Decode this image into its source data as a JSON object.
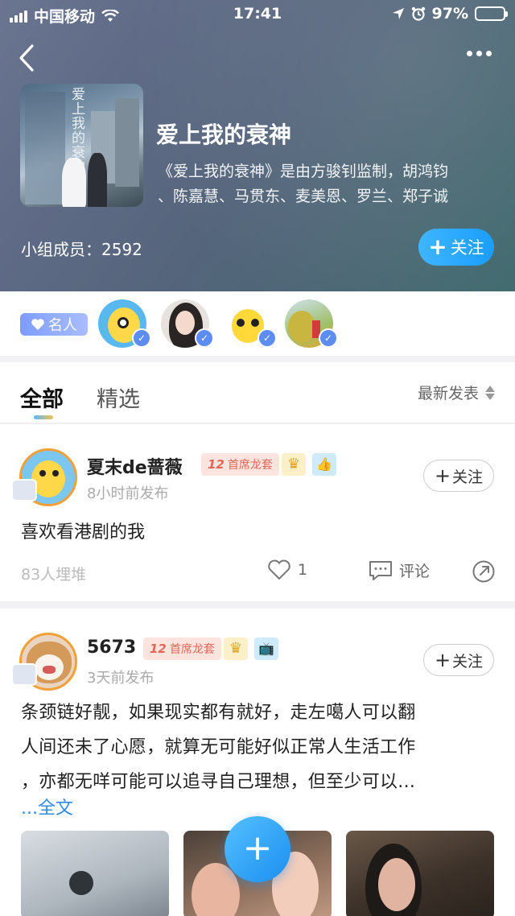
{
  "status_bar": {
    "carrier": "中国移动",
    "time": "17:41",
    "battery": "97%",
    "battery_level": 0.97
  },
  "group": {
    "title": "爱上我的衰神",
    "desc_line1": "《爱上我的衰神》是由方骏钊监制，胡鸿钧",
    "desc_line2": "、陈嘉慧、马贯东、麦美恩、罗兰、郑子诚",
    "members": "小组成员：2592",
    "follow_label": "关注",
    "poster_title": "爱上我的衰神"
  },
  "celebs": {
    "badge_label": "名人",
    "avatars": [
      "celeb-1",
      "celeb-2",
      "celeb-3",
      "celeb-4"
    ]
  },
  "tabs": {
    "all": "全部",
    "selected": "精选",
    "sort": "最新发表"
  },
  "posts": [
    {
      "name": "夏末de蔷薇",
      "level": "12",
      "rank": "首席龙套",
      "time": "8小时前发布",
      "text": "喜欢看港剧的我",
      "stat": "83人埋堆",
      "likes": "1",
      "comment": "评论",
      "follow": "关注"
    },
    {
      "name": "5673",
      "level": "12",
      "rank": "首席龙套",
      "time": "3天前发布",
      "text_line1": "条颈链好靓，如果现实都有就好，走左噶人可以翻",
      "text_line2": "人间还未了心愿，就算无可能好似正常人生活工作",
      "text_line3": "，亦都无咩可能可以追寻自己理想，但至少可以...",
      "more": "...全文",
      "follow": "关注"
    }
  ],
  "fab_label": "+"
}
